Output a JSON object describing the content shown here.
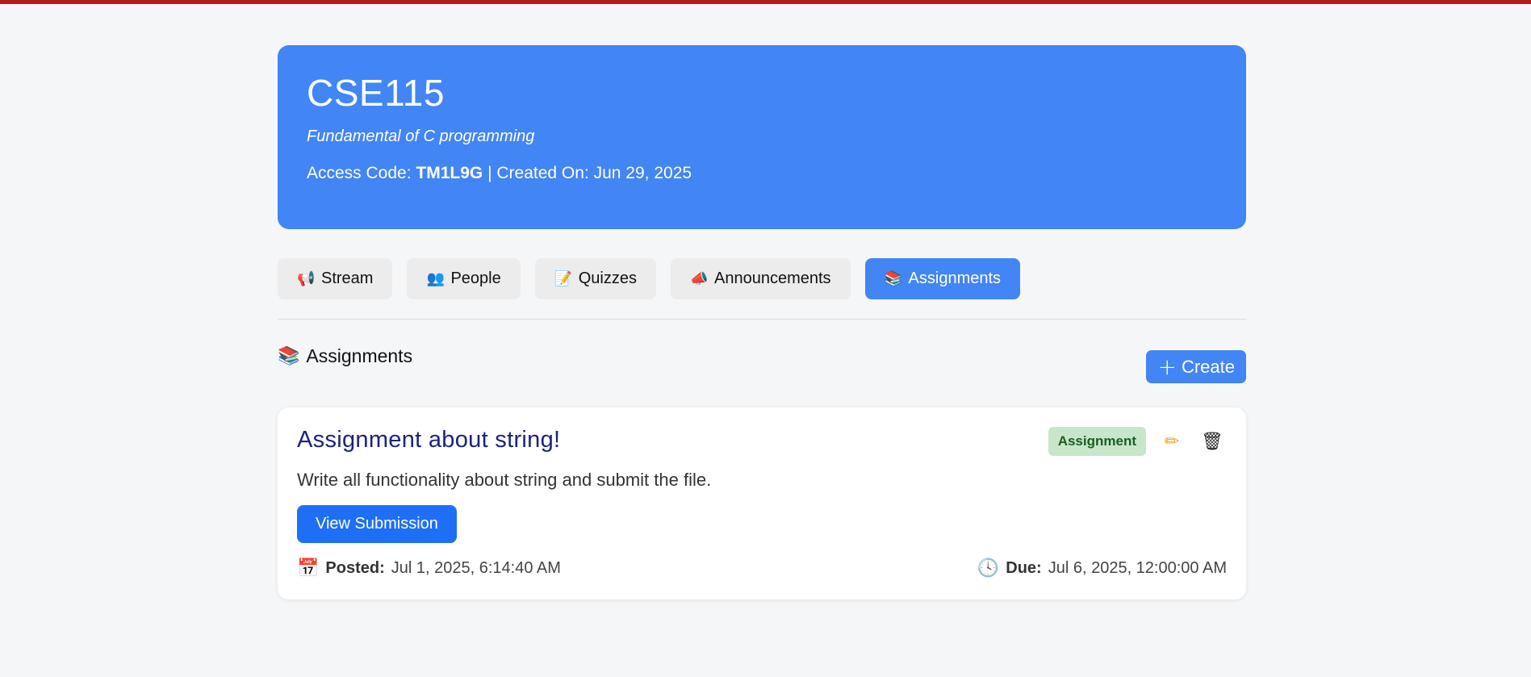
{
  "course": {
    "code": "CSE115",
    "name": "Fundamental of C programming",
    "access_code_label": "Access Code:",
    "access_code": "TM1L9G",
    "created_label": "| Created On: Jun 29, 2025"
  },
  "tabs": [
    {
      "label": "Stream",
      "icon": "megaphone-icon",
      "glyph": "📢"
    },
    {
      "label": "People",
      "icon": "people-icon",
      "glyph": "👥"
    },
    {
      "label": "Quizzes",
      "icon": "memo-icon",
      "glyph": "📝"
    },
    {
      "label": "Announcements",
      "icon": "loudspeaker-icon",
      "glyph": "📣"
    },
    {
      "label": "Assignments",
      "icon": "books-icon",
      "glyph": "📚",
      "active": true
    }
  ],
  "section": {
    "title": "Assignments",
    "icon": "books-icon",
    "glyph": "📚",
    "create_label": "Create",
    "create_glyph": "+"
  },
  "assignment": {
    "title": "Assignment about string!",
    "description": "Write all functionality about string and submit the file.",
    "badge": "Assignment",
    "view_label": "View Submission",
    "edit_glyph": "✏",
    "delete_glyph": "🗑",
    "posted_label": "Posted:",
    "posted_value": "Jul 1, 2025, 6:14:40 AM",
    "posted_glyph": "📅",
    "due_label": "Due:",
    "due_value": "Jul 6, 2025, 12:00:00 AM",
    "due_glyph": "🕓"
  },
  "colors": {
    "accent": "#4285f4",
    "topbar": "#b71c1c",
    "badge_bg": "#c8e6c9",
    "badge_text": "#1b5e20",
    "title_text": "#1a237e"
  }
}
